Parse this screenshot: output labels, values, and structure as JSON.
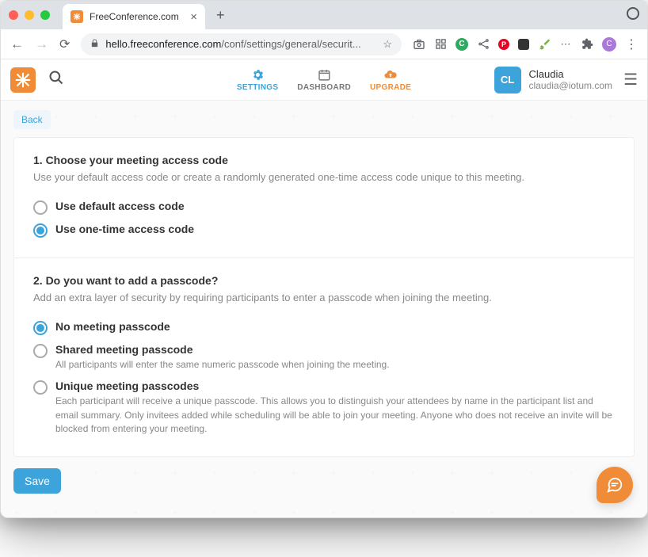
{
  "browser": {
    "tab_title": "FreeConference.com",
    "url_domain": "hello.freeconference.com",
    "url_path": "/conf/settings/general/securit..."
  },
  "header": {
    "nav": {
      "settings": "SETTINGS",
      "dashboard": "DASHBOARD",
      "upgrade": "UPGRADE"
    },
    "user": {
      "initials": "CL",
      "name": "Claudia",
      "email": "claudia@iotum.com"
    }
  },
  "body": {
    "back_label": "Back",
    "section1": {
      "title": "1. Choose your meeting access code",
      "desc": "Use your default access code or create a randomly generated one-time access code unique to this meeting.",
      "opt_default": "Use default access code",
      "opt_onetime": "Use one-time access code"
    },
    "section2": {
      "title": "2. Do you want to add a passcode?",
      "desc": "Add an extra layer of security by requiring participants to enter a passcode when joining the meeting.",
      "opt_none": "No meeting passcode",
      "opt_shared": "Shared meeting passcode",
      "opt_shared_desc": "All participants will enter the same numeric passcode when joining the meeting.",
      "opt_unique": "Unique meeting passcodes",
      "opt_unique_desc": "Each participant will receive a unique passcode. This allows you to distinguish your attendees by name in the participant list and email summary. Only invitees added while scheduling will be able to join your meeting. Anyone who does not receive an invite will be blocked from entering your meeting."
    },
    "save_label": "Save"
  }
}
